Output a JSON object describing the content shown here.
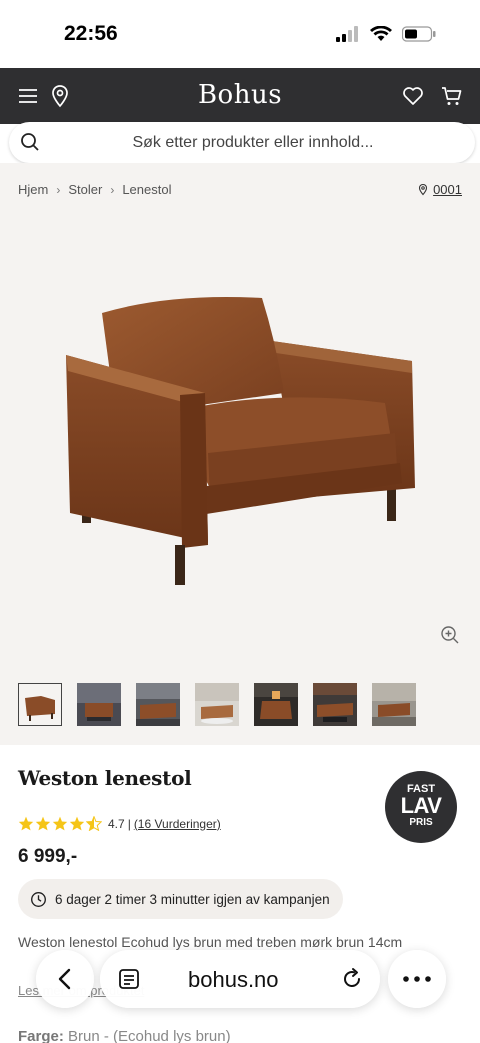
{
  "status_bar": {
    "time": "22:56"
  },
  "header": {
    "brand": "Bohus"
  },
  "search": {
    "placeholder": "Søk etter produkter eller innhold..."
  },
  "breadcrumb": {
    "items": [
      "Hjem",
      "Stoler",
      "Lenestol"
    ],
    "store": "0001"
  },
  "product": {
    "title": "Weston lenestol",
    "rating": "4.7",
    "rating_separator": "|",
    "reviews": "(16 Vurderinger)",
    "price": "6 999,-",
    "campaign": "6 dager 2 timer 3 minutter igjen av kampanjen",
    "description": "Weston lenestol Ecohud lys brun med treben mørk brun 14cm",
    "read_more": "Les mer om produktet",
    "color_label": "Farge:",
    "color_value": "Brun - (Ecohud lys brun)",
    "stars": 4.5
  },
  "badge": {
    "line1": "FAST",
    "line2": "LAV",
    "line3": "PRIS"
  },
  "browser": {
    "url": "bohus.no"
  },
  "colors": {
    "header_bg": "#2f2f31",
    "star": "#f5c518",
    "product_bg": "#f5f3f1"
  }
}
